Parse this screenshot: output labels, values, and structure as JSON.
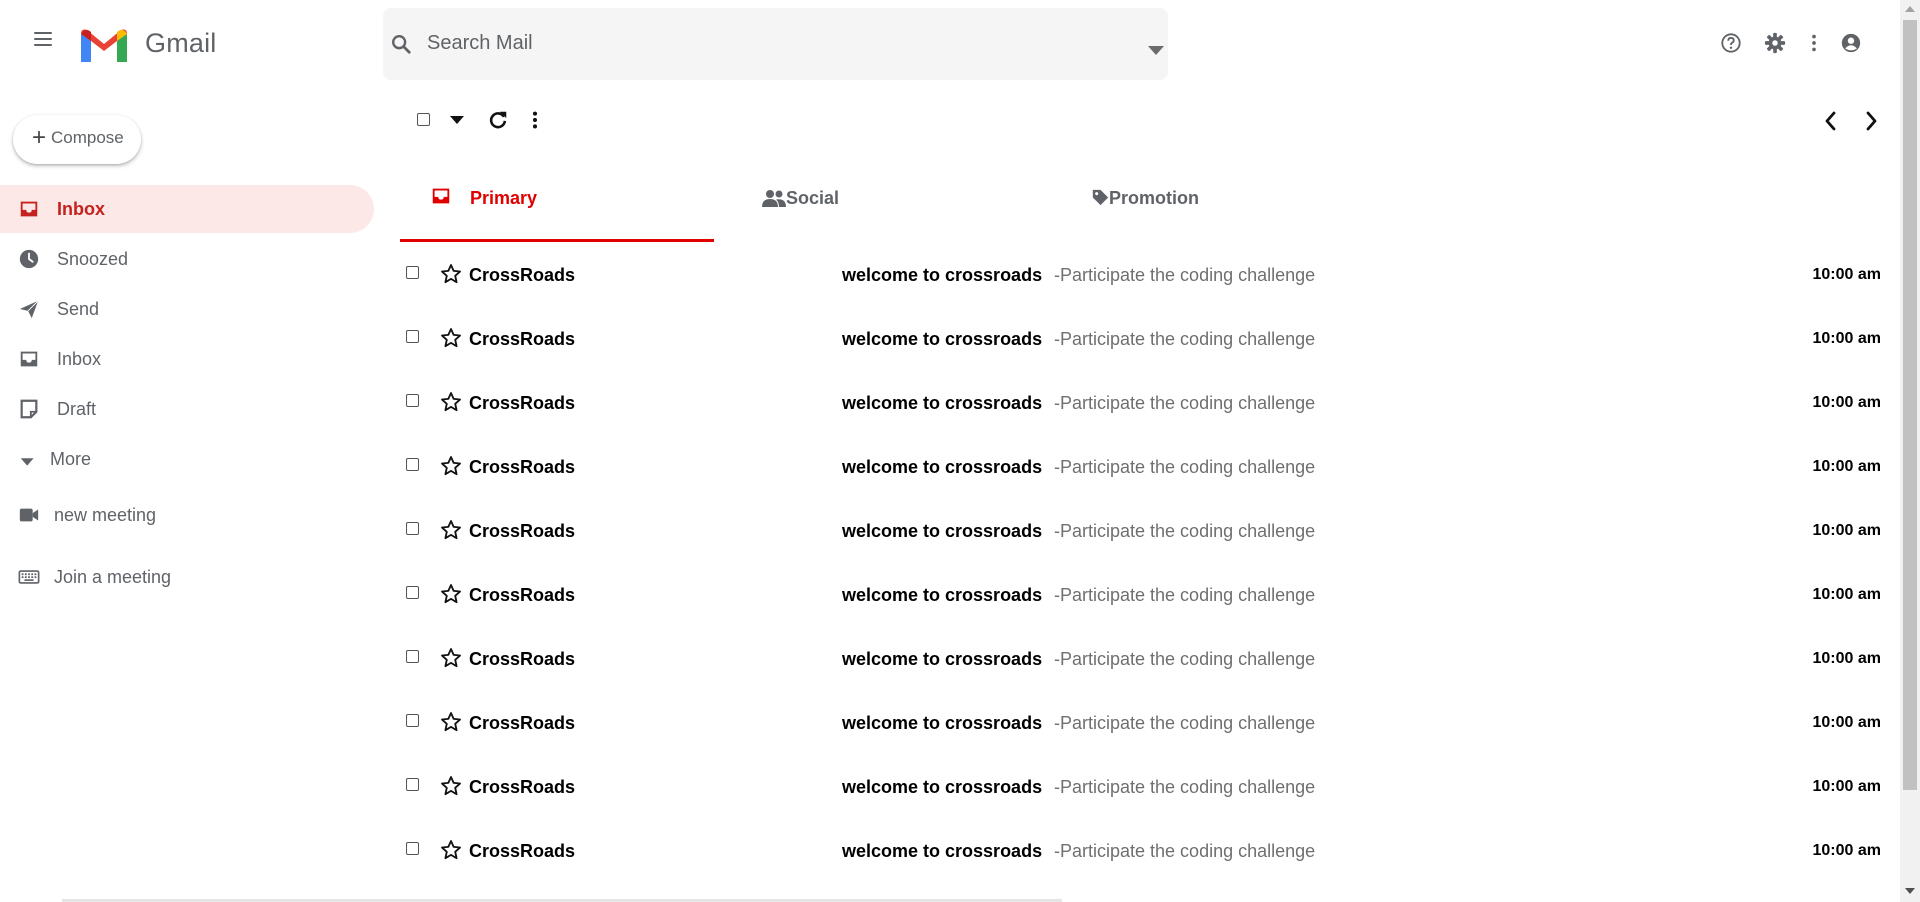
{
  "app": {
    "brand": "Gmail"
  },
  "header": {
    "search_placeholder": "Search Mail",
    "icons": [
      "menu-icon",
      "gmail-logo",
      "search-icon",
      "dropdown-caret-icon",
      "help-icon",
      "settings-icon",
      "more-vert-icon",
      "account-icon"
    ]
  },
  "sidebar": {
    "compose_plus": "+",
    "compose_label": "Compose",
    "items": [
      {
        "label": "Inbox",
        "icon": "inbox-icon",
        "active": true
      },
      {
        "label": "Snoozed",
        "icon": "clock-icon"
      },
      {
        "label": "Send",
        "icon": "send-icon"
      },
      {
        "label": "Inbox",
        "icon": "inbox-icon"
      },
      {
        "label": "Draft",
        "icon": "draft-icon"
      },
      {
        "label": "More",
        "icon": "caret-down-icon"
      },
      {
        "label": "new meeting",
        "icon": "video-icon"
      },
      {
        "label": "Join a meeting",
        "icon": "keyboard-icon"
      }
    ]
  },
  "tabs": [
    {
      "label": "Primary",
      "icon": "inbox-icon",
      "active": true
    },
    {
      "label": "Social",
      "icon": "people-icon"
    },
    {
      "label": "Promotion",
      "icon": "tag-icon"
    }
  ],
  "emails": [
    {
      "sender": "CrossRoads",
      "subject": "welcome to crossroads",
      "snippet": " -Participate the coding challenge",
      "time": "10:00 am"
    },
    {
      "sender": "CrossRoads",
      "subject": "welcome to crossroads",
      "snippet": " -Participate the coding challenge",
      "time": "10:00 am"
    },
    {
      "sender": "CrossRoads",
      "subject": "welcome to crossroads",
      "snippet": " -Participate the coding challenge",
      "time": "10:00 am"
    },
    {
      "sender": "CrossRoads",
      "subject": "welcome to crossroads",
      "snippet": " -Participate the coding challenge",
      "time": "10:00 am"
    },
    {
      "sender": "CrossRoads",
      "subject": "welcome to crossroads",
      "snippet": " -Participate the coding challenge",
      "time": "10:00 am"
    },
    {
      "sender": "CrossRoads",
      "subject": "welcome to crossroads",
      "snippet": " -Participate the coding challenge",
      "time": "10:00 am"
    },
    {
      "sender": "CrossRoads",
      "subject": "welcome to crossroads",
      "snippet": " -Participate the coding challenge",
      "time": "10:00 am"
    },
    {
      "sender": "CrossRoads",
      "subject": "welcome to crossroads",
      "snippet": " -Participate the coding challenge",
      "time": "10:00 am"
    },
    {
      "sender": "CrossRoads",
      "subject": "welcome to crossroads",
      "snippet": " -Participate the coding challenge",
      "time": "10:00 am"
    },
    {
      "sender": "CrossRoads",
      "subject": "welcome to crossroads",
      "snippet": " -Participate the coding challenge",
      "time": "10:00 am"
    }
  ],
  "colors": {
    "accent": "#e00000",
    "active_bg": "#fce8e6",
    "active_text": "#c5221f",
    "muted": "#5f6368"
  }
}
